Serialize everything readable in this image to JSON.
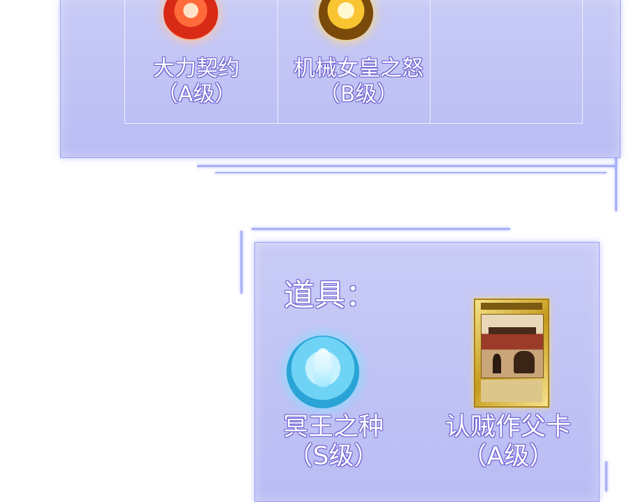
{
  "skills": [
    {
      "name": "大力契约",
      "grade": "（A级）",
      "icon": "fist-icon"
    },
    {
      "name": "机械女皇之怒",
      "grade": "（B级）",
      "icon": "fury-icon"
    }
  ],
  "items_section": {
    "title": "道具：",
    "items": [
      {
        "name": "冥王之种",
        "grade": "（S级）",
        "icon": "crystal-seed-icon"
      },
      {
        "name": "认贼作父卡",
        "grade": "（A级）",
        "icon": "card-icon"
      }
    ]
  },
  "colors": {
    "panel": "#c0c3f5",
    "glow": "#9ea4f1",
    "text_outline": "#6c5fd1"
  }
}
